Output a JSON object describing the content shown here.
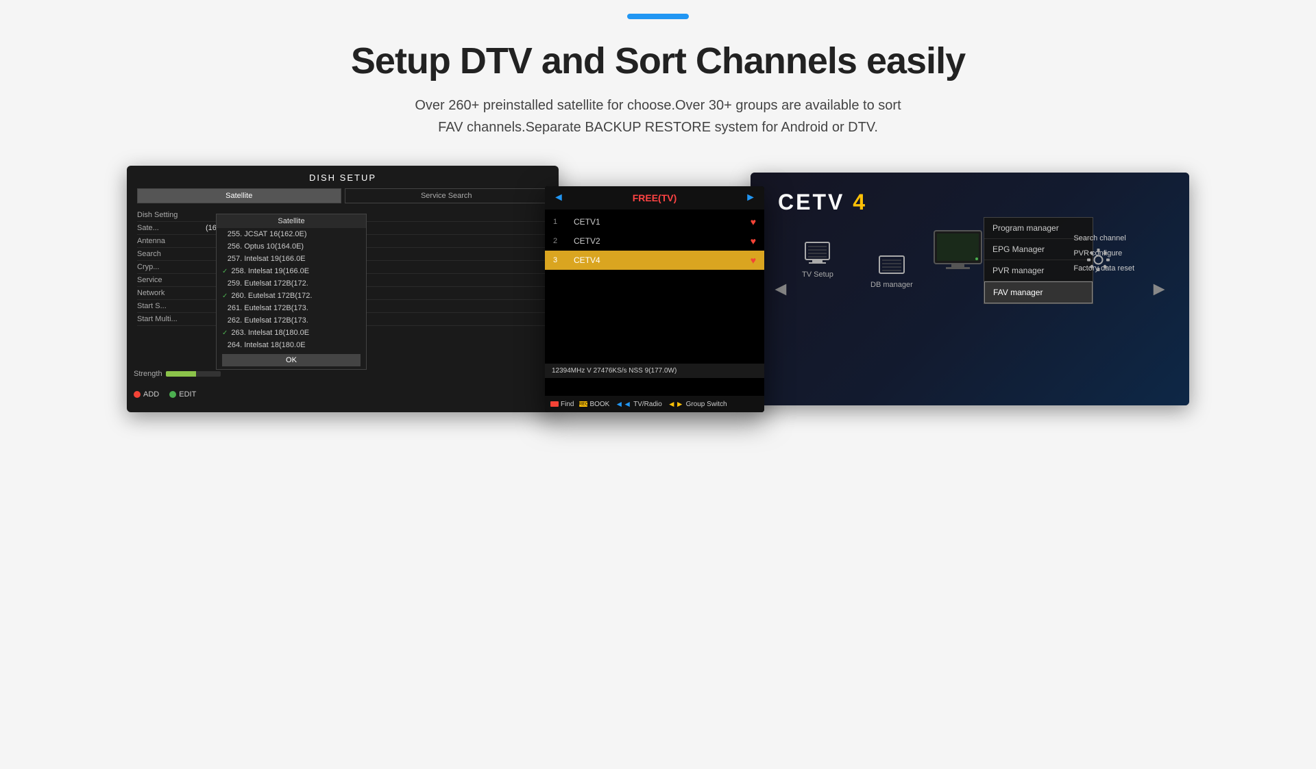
{
  "topbar": {
    "line_color": "#2196F3"
  },
  "header": {
    "title": "Setup DTV and Sort Channels easily",
    "subtitle_line1": "Over 260+ preinstalled satellite for choose.Over 30+ groups are available to sort",
    "subtitle_line2": "FAV channels.Separate BACKUP RESTORE system for Android or DTV."
  },
  "dish_setup": {
    "title": "DISH SETUP",
    "tabs": [
      "Satellite",
      "Service Search"
    ],
    "form_rows": [
      {
        "label": "Dish Setting",
        "value": ""
      },
      {
        "label": "Sate...",
        "value": ""
      },
      {
        "label": "Antenna",
        "value": ""
      },
      {
        "label": "Search",
        "value": ""
      },
      {
        "label": "Cryp...",
        "value": ""
      },
      {
        "label": "Service",
        "value": ""
      },
      {
        "label": "Network",
        "value": ""
      },
      {
        "label": "Start S...",
        "value": ""
      },
      {
        "label": "Start Multi...",
        "value": ""
      }
    ],
    "satellite_dropdown": {
      "title": "Satellite",
      "items": [
        {
          "num": "255.",
          "name": "JCSAT 16(162.0E)",
          "checked": false
        },
        {
          "num": "256.",
          "name": "Optus 10(164.0E)",
          "checked": false
        },
        {
          "num": "257.",
          "name": "Intelsat 19(166.0E",
          "checked": false
        },
        {
          "num": "258.",
          "name": "Intelsat 19(166.0E",
          "checked": true
        },
        {
          "num": "259.",
          "name": "Eutelsat 172B(172.",
          "checked": false
        },
        {
          "num": "260.",
          "name": "Eutelsat 172B(172.",
          "checked": true
        },
        {
          "num": "261.",
          "name": "Eutelsat 172B(173.",
          "checked": false
        },
        {
          "num": "262.",
          "name": "Eutelsat 172B(173.",
          "checked": false
        },
        {
          "num": "263.",
          "name": "Intelsat 18(180.0E",
          "checked": true
        },
        {
          "num": "264.",
          "name": "Intelsat 18(180.0E",
          "checked": false
        }
      ],
      "ok_label": "OK"
    },
    "add_label": "ADD",
    "edit_label": "EDIT",
    "strength_label": "Strength"
  },
  "channel_list": {
    "title": "FREE(TV)",
    "items": [
      {
        "num": "1",
        "name": "CETV1",
        "fav": true
      },
      {
        "num": "2",
        "name": "CETV2",
        "fav": true
      },
      {
        "num": "3",
        "name": "CETV4",
        "fav": true,
        "highlighted": true
      }
    ],
    "info_bar": "12394MHz  V  27476KS/s  NSS 9(177.0W)",
    "controls": [
      {
        "color": "red",
        "label": "Find"
      },
      {
        "color": "yellow",
        "label": "BOOK"
      },
      {
        "color": "rewind",
        "label": "TV/Radio"
      },
      {
        "color": "ff",
        "label": "Group Switch"
      }
    ]
  },
  "cetv_screen": {
    "logo": "CETV",
    "logo_num": "4",
    "menu_items": [
      {
        "label": "Program manager"
      },
      {
        "label": "EPG Manager"
      },
      {
        "label": "PVR manager"
      },
      {
        "label": "FAV manager",
        "active": true
      }
    ],
    "right_menu": [
      {
        "label": "Search channel"
      },
      {
        "label": "PVR configure"
      },
      {
        "label": "Factory data reset"
      }
    ],
    "tv_setup_label": "TV Setup",
    "db_manager_label": "DB manager"
  }
}
